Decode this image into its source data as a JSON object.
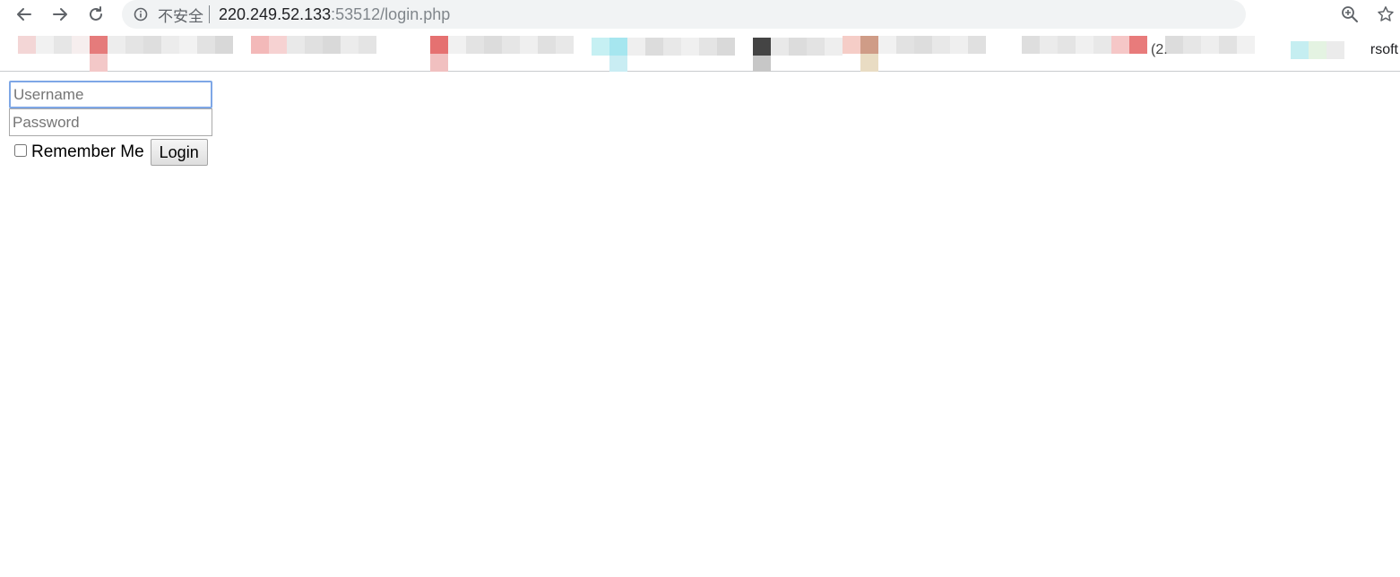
{
  "browser": {
    "back_icon": "arrow-left-icon",
    "forward_icon": "arrow-right-icon",
    "reload_icon": "reload-icon",
    "security_icon": "info-circle-icon",
    "security_label": "不安全",
    "url_host": "220.249.52.133",
    "url_port_path": ":53512/login.php",
    "zoom_icon": "zoom-in-icon",
    "bookmark_icon": "star-icon",
    "bookmarks_tail_text": "rsoft",
    "bookmarks_fragment_text": "(2."
  },
  "login_form": {
    "username_placeholder": "Username",
    "password_placeholder": "Password",
    "remember_label": "Remember Me",
    "remember_checked": false,
    "login_button_label": "Login"
  },
  "colors": {
    "address_bar_bg": "#f1f3f4",
    "focus_ring": "#7ea7e6"
  }
}
